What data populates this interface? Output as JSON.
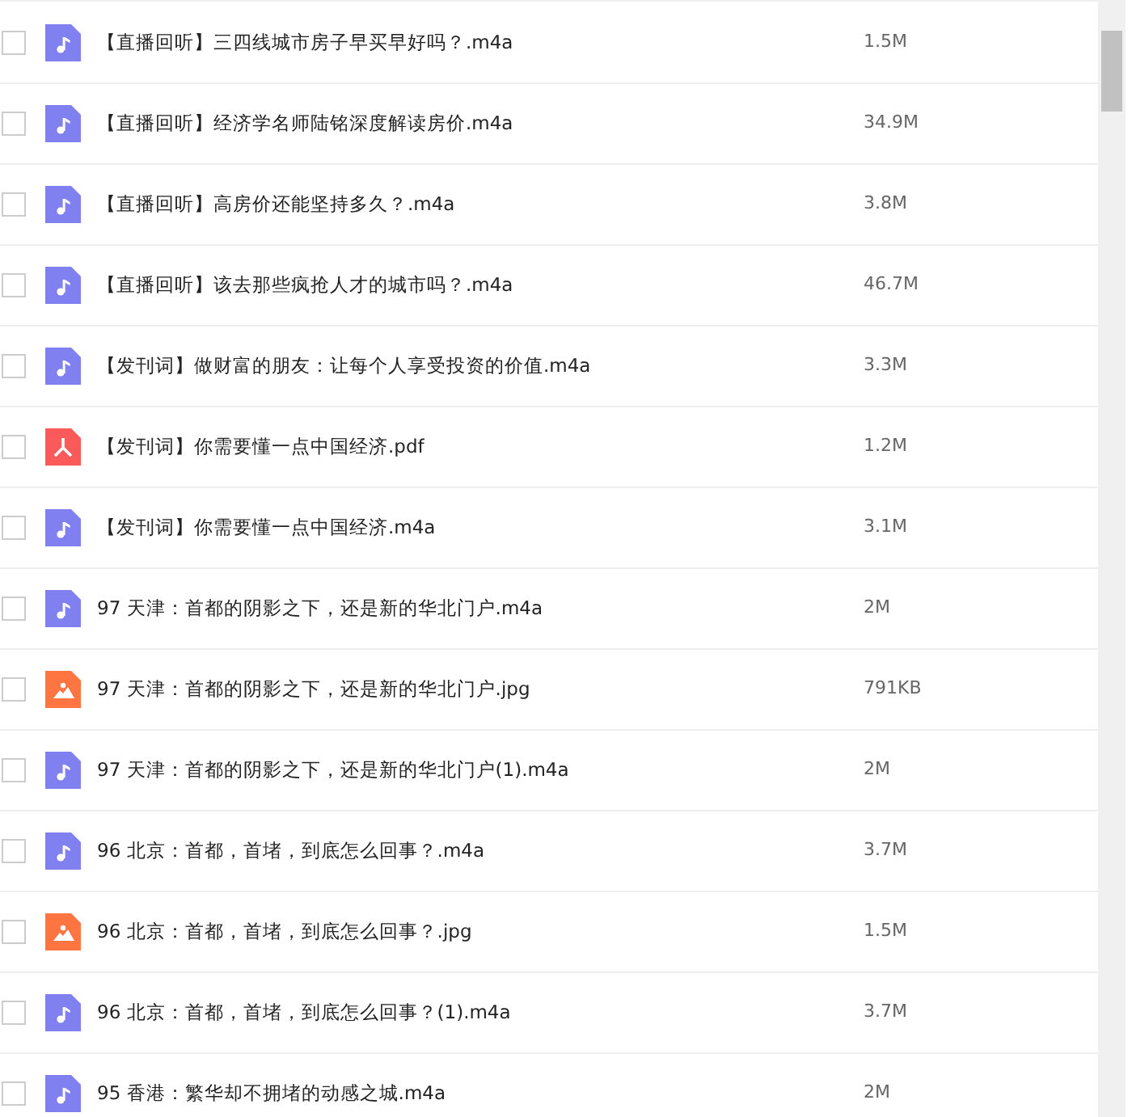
{
  "files": [
    {
      "kind": "audio",
      "name": "【直播回听】三四线城市房子早买早好吗？.m4a",
      "size": "1.5M",
      "checked": false
    },
    {
      "kind": "audio",
      "name": "【直播回听】经济学名师陆铭深度解读房价.m4a",
      "size": "34.9M",
      "checked": false
    },
    {
      "kind": "audio",
      "name": "【直播回听】高房价还能坚持多久？.m4a",
      "size": "3.8M",
      "checked": false
    },
    {
      "kind": "audio",
      "name": "【直播回听】该去那些疯抢人才的城市吗？.m4a",
      "size": "46.7M",
      "checked": false
    },
    {
      "kind": "audio",
      "name": "【发刊词】做财富的朋友：让每个人享受投资的价值.m4a",
      "size": "3.3M",
      "checked": false
    },
    {
      "kind": "pdf",
      "name": "【发刊词】你需要懂一点中国经济.pdf",
      "size": "1.2M",
      "checked": false
    },
    {
      "kind": "audio",
      "name": "【发刊词】你需要懂一点中国经济.m4a",
      "size": "3.1M",
      "checked": false
    },
    {
      "kind": "audio",
      "name": "97 天津：首都的阴影之下，还是新的华北门户.m4a",
      "size": "2M",
      "checked": false
    },
    {
      "kind": "image",
      "name": "97 天津：首都的阴影之下，还是新的华北门户.jpg",
      "size": "791KB",
      "checked": false
    },
    {
      "kind": "audio",
      "name": "97 天津：首都的阴影之下，还是新的华北门户(1).m4a",
      "size": "2M",
      "checked": false
    },
    {
      "kind": "audio",
      "name": "96 北京：首都，首堵，到底怎么回事？.m4a",
      "size": "3.7M",
      "checked": false
    },
    {
      "kind": "image",
      "name": "96 北京：首都，首堵，到底怎么回事？.jpg",
      "size": "1.5M",
      "checked": false
    },
    {
      "kind": "audio",
      "name": "96 北京：首都，首堵，到底怎么回事？(1).m4a",
      "size": "3.7M",
      "checked": false
    },
    {
      "kind": "audio",
      "name": "95 香港：繁华却不拥堵的动感之城.m4a",
      "size": "2M",
      "checked": false
    }
  ]
}
